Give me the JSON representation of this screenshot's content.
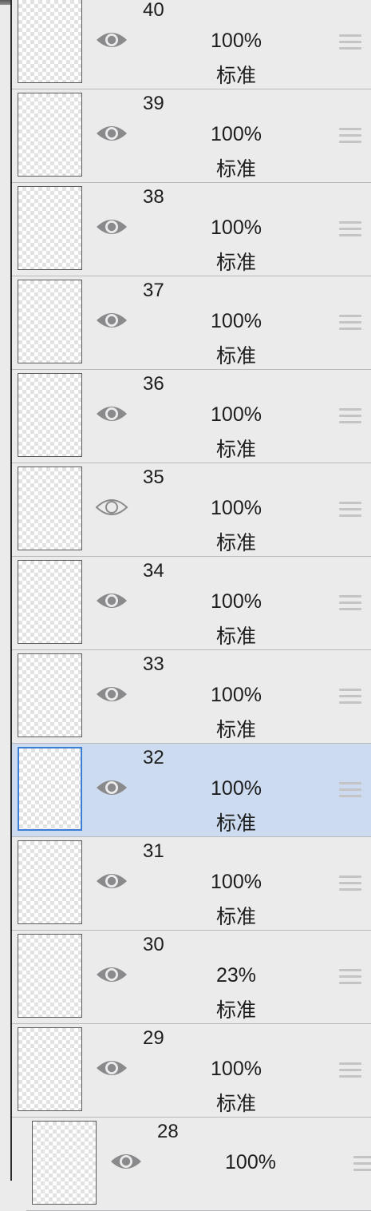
{
  "layers": [
    {
      "number": "40",
      "opacity": "100%",
      "blend": "标准",
      "visible": true,
      "selected": false,
      "eye_icon": "eye-filled-icon"
    },
    {
      "number": "39",
      "opacity": "100%",
      "blend": "标准",
      "visible": true,
      "selected": false,
      "eye_icon": "eye-filled-icon"
    },
    {
      "number": "38",
      "opacity": "100%",
      "blend": "标准",
      "visible": true,
      "selected": false,
      "eye_icon": "eye-filled-icon"
    },
    {
      "number": "37",
      "opacity": "100%",
      "blend": "标准",
      "visible": true,
      "selected": false,
      "eye_icon": "eye-filled-icon"
    },
    {
      "number": "36",
      "opacity": "100%",
      "blend": "标准",
      "visible": true,
      "selected": false,
      "eye_icon": "eye-filled-icon"
    },
    {
      "number": "35",
      "opacity": "100%",
      "blend": "标准",
      "visible": false,
      "selected": false,
      "eye_icon": "eye-outline-icon"
    },
    {
      "number": "34",
      "opacity": "100%",
      "blend": "标准",
      "visible": true,
      "selected": false,
      "eye_icon": "eye-filled-icon"
    },
    {
      "number": "33",
      "opacity": "100%",
      "blend": "标准",
      "visible": true,
      "selected": false,
      "eye_icon": "eye-filled-icon"
    },
    {
      "number": "32",
      "opacity": "100%",
      "blend": "标准",
      "visible": true,
      "selected": true,
      "eye_icon": "eye-filled-icon"
    },
    {
      "number": "31",
      "opacity": "100%",
      "blend": "标准",
      "visible": true,
      "selected": false,
      "eye_icon": "eye-filled-icon"
    },
    {
      "number": "30",
      "opacity": "23%",
      "blend": "标准",
      "visible": true,
      "selected": false,
      "eye_icon": "eye-filled-icon"
    },
    {
      "number": "29",
      "opacity": "100%",
      "blend": "标准",
      "visible": true,
      "selected": false,
      "eye_icon": "eye-filled-icon"
    },
    {
      "number": "28",
      "opacity": "100%",
      "blend": "",
      "visible": true,
      "selected": false,
      "eye_icon": "eye-filled-icon"
    }
  ],
  "colors": {
    "panel_bg": "#ebebec",
    "selected_bg": "#ccdbef",
    "selected_border": "#3a7fd6",
    "eye_color": "#8a8a8c"
  }
}
